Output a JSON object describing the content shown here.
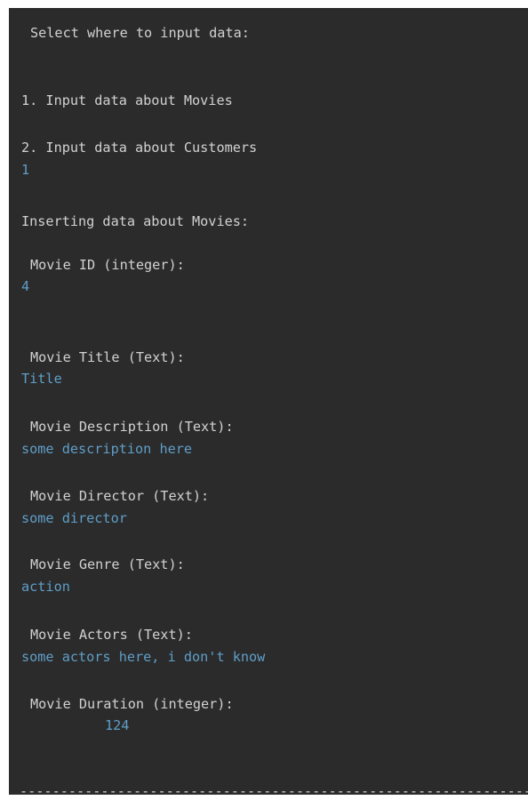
{
  "header": {
    "prompt": "Select where to input data:"
  },
  "menu": {
    "option1": "1. Input data about Movies",
    "option2": "2. Input data about Customers"
  },
  "menu_choice": "1",
  "section_title": "Inserting data about Movies:",
  "fields": {
    "movie_id": {
      "label": "Movie ID (integer):",
      "value": "4"
    },
    "movie_title": {
      "label": "Movie Title (Text):",
      "value": "Title"
    },
    "movie_description": {
      "label": "Movie Description (Text):",
      "value": "some description here"
    },
    "movie_director": {
      "label": "Movie Director (Text):",
      "value": "some director"
    },
    "movie_genre": {
      "label": "Movie Genre (Text):",
      "value": "action"
    },
    "movie_actors": {
      "label": "Movie Actors (Text):",
      "value": "some actors here, i don't know"
    },
    "movie_duration": {
      "label": "Movie Duration (integer):",
      "value": "124"
    }
  },
  "separator": "----------------------------------------------------------------"
}
